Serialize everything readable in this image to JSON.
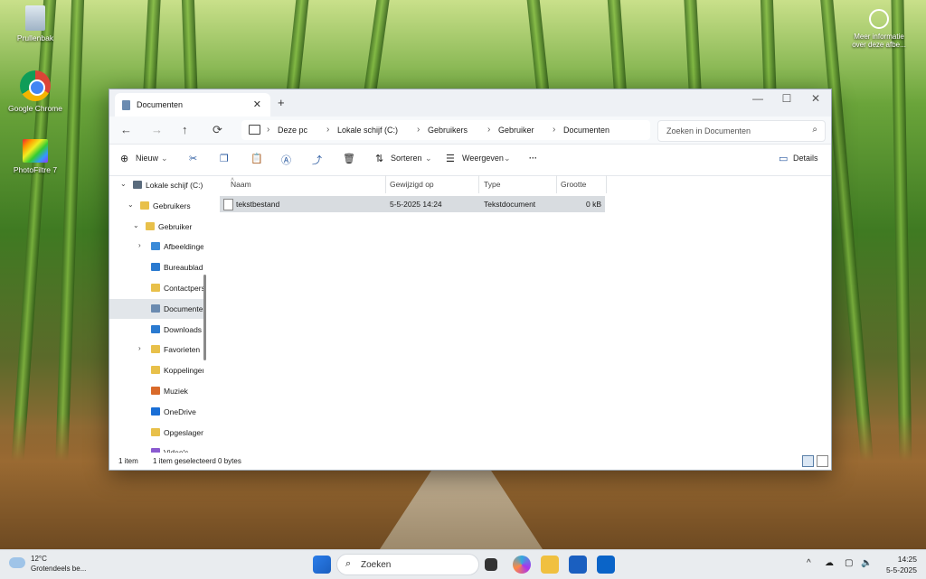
{
  "desktop": {
    "icons": [
      {
        "label": "Prullenbak"
      },
      {
        "label": "Google Chrome"
      },
      {
        "label": "PhotoFiltre 7"
      }
    ],
    "spotlight": {
      "line1": "Meer informatie",
      "line2": "over deze afbe..."
    }
  },
  "explorer": {
    "tab_title": "Documenten",
    "tab_close": "✕",
    "new_tab": "+",
    "window_controls": {
      "minimize": "—",
      "maximize": "☐",
      "close": "✕"
    },
    "nav": {
      "back": "←",
      "forward": "→",
      "up": "↑",
      "refresh": "⟳"
    },
    "breadcrumb": [
      "Deze pc",
      "Lokale schijf (C:)",
      "Gebruikers",
      "Gebruiker",
      "Documenten"
    ],
    "search_placeholder": "Zoeken in Documenten",
    "toolbar": {
      "new_label": "Nieuw",
      "sort_label": "Sorteren",
      "view_label": "Weergeven",
      "more_label": "···",
      "details_label": "Details"
    },
    "sidebar": [
      {
        "label": "Lokale schijf (C:)",
        "chev": "⌄",
        "indent": 0,
        "color": "#5a6b7d"
      },
      {
        "label": "Gebruikers",
        "chev": "⌄",
        "indent": 1,
        "color": "#e8c04a"
      },
      {
        "label": "Gebruiker",
        "chev": "⌄",
        "indent": 2,
        "color": "#e8c04a"
      },
      {
        "label": "Afbeeldingen",
        "chev": "›",
        "indent": 3,
        "color": "#3a8ad8"
      },
      {
        "label": "Bureaublad",
        "chev": "",
        "indent": 3,
        "color": "#2a7ad0"
      },
      {
        "label": "Contactpersonen",
        "chev": "",
        "indent": 3,
        "color": "#e8c04a"
      },
      {
        "label": "Documenten",
        "chev": "",
        "indent": 3,
        "color": "#6b8bb0"
      },
      {
        "label": "Downloads",
        "chev": "",
        "indent": 3,
        "color": "#2a7ad0"
      },
      {
        "label": "Favorieten",
        "chev": "›",
        "indent": 3,
        "color": "#e8c04a"
      },
      {
        "label": "Koppelingen",
        "chev": "",
        "indent": 3,
        "color": "#e8c04a"
      },
      {
        "label": "Muziek",
        "chev": "",
        "indent": 3,
        "color": "#d96a2a"
      },
      {
        "label": "OneDrive",
        "chev": "",
        "indent": 3,
        "color": "#1a6fd6"
      },
      {
        "label": "Opgeslagen spellen",
        "chev": "",
        "indent": 3,
        "color": "#e8c04a"
      },
      {
        "label": "Video's",
        "chev": "",
        "indent": 3,
        "color": "#8a5ad0"
      }
    ],
    "columns": {
      "name": "Naam",
      "modified": "Gewijzigd op",
      "type": "Type",
      "size": "Grootte"
    },
    "files": [
      {
        "name": "tekstbestand",
        "modified": "5-5-2025 14:24",
        "type": "Tekstdocument",
        "size": "0 kB"
      }
    ],
    "status": {
      "count": "1 item",
      "selected": "1 item geselecteerd  0 bytes"
    }
  },
  "taskbar": {
    "weather_temp": "12°C",
    "weather_desc": "Grotendeels be...",
    "search_placeholder": "Zoeken",
    "time": "14:25",
    "date": "5-5-2025",
    "tray_chevron": "^"
  }
}
